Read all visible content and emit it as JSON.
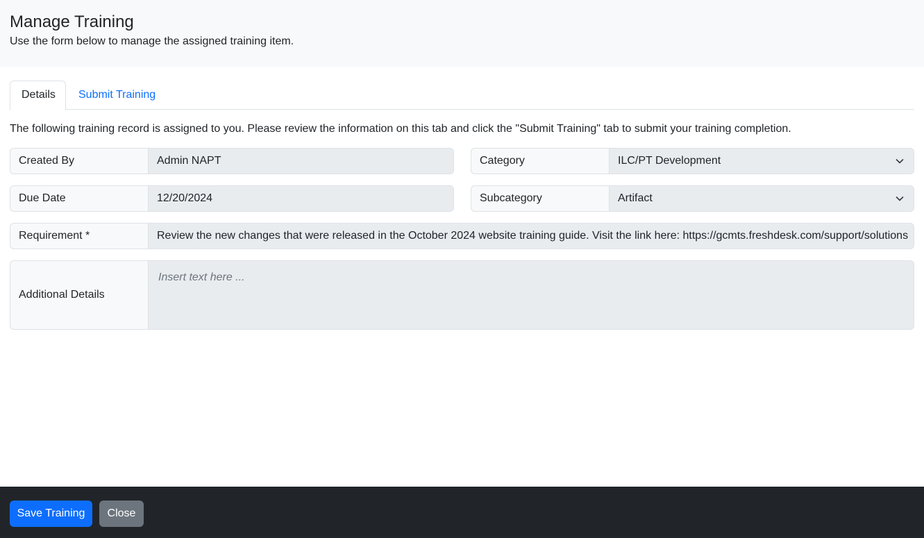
{
  "header": {
    "title": "Manage Training",
    "subtitle": "Use the form below to manage the assigned training item."
  },
  "tabs": [
    {
      "label": "Details",
      "active": true
    },
    {
      "label": "Submit Training",
      "active": false
    }
  ],
  "intro_text": "The following training record is assigned to you. Please review the information on this tab and click the \"Submit Training\" tab to submit your training completion.",
  "form": {
    "created_by": {
      "label": "Created By",
      "value": "Admin NAPT"
    },
    "category": {
      "label": "Category",
      "value": "ILC/PT Development"
    },
    "due_date": {
      "label": "Due Date",
      "value": "12/20/2024"
    },
    "subcategory": {
      "label": "Subcategory",
      "value": "Artifact"
    },
    "requirement": {
      "label": "Requirement *",
      "value": "Review the new changes that were released in the October 2024 website training guide. Visit the link here: https://gcmts.freshdesk.com/support/solutions"
    },
    "additional_details": {
      "label": "Additional Details",
      "placeholder": "Insert text here ..."
    }
  },
  "footer": {
    "save_label": "Save Training",
    "close_label": "Close"
  },
  "colors": {
    "primary": "#0d6efd",
    "secondary": "#6c757d",
    "footer_bg": "#212529"
  },
  "icons": {
    "select_arrow": "chevron-down-icon"
  }
}
